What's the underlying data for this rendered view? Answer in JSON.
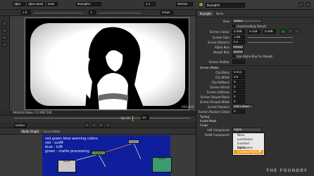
{
  "viewer": {
    "layer": "rgba",
    "alpha_layer": "rgba.alpha",
    "colorspace": "RGB",
    "input_a": "Keylight1",
    "gain": "1.0",
    "gamma": "1",
    "zoom": "1:1",
    "proxy": "sRGB",
    "lut": "default",
    "resolution": "960x540",
    "format_label": "960x540",
    "status": "960x540 bbox: 0 0 960 540",
    "frame": "24",
    "fps": "fps 24",
    "range_mode": "Global"
  },
  "node_panel": {
    "tabs": [
      "Node Graph",
      "Curve Editor"
    ],
    "sticky_note_lines": [
      "red green blue warning colors",
      "red - outM",
      "blue - inM",
      "green - matte processing"
    ],
    "nodes": [
      {
        "label": "Keylight1",
        "color": "#6fa04a"
      },
      {
        "label": "Read1",
        "color": "#c8c8c8"
      },
      {
        "label": "Read2",
        "color": "#c8c8c8"
      },
      {
        "label": "Viewer1",
        "color": "#9ab"
      }
    ]
  },
  "properties": {
    "title": "Keylight1",
    "tabs": [
      "Keylight",
      "Node"
    ],
    "view": {
      "label": "View",
      "value": "Status"
    },
    "unpremultiply": {
      "label": "Unpremultiply Result"
    },
    "screen_colour": {
      "label": "Screen Colour",
      "r": "0.008",
      "g": "0.358",
      "b": "0.008"
    },
    "rows": [
      {
        "label": "Screen Gain",
        "value": "1.08"
      },
      {
        "label": "Screen Balance",
        "value": "0.5"
      },
      {
        "label": "Alpha Bias",
        "value": ""
      },
      {
        "label": "Despill Bias",
        "value": ""
      }
    ],
    "use_alpha_despill": "Use Alpha Bias for Despill",
    "screen_prematte": "Screen PreBlur",
    "screen_matte_section": "Screen Matte",
    "matte_rows": [
      {
        "label": "Clip Black",
        "value": "0.015"
      },
      {
        "label": "Clip White",
        "value": "0.6"
      },
      {
        "label": "Clip Rollback",
        "value": "0"
      },
      {
        "label": "Screen Shrink",
        "value": "0"
      },
      {
        "label": "Screen Softness",
        "value": "0"
      },
      {
        "label": "Screen Despot Black",
        "value": "0"
      },
      {
        "label": "Screen Despot White",
        "value": "0"
      }
    ],
    "screen_replace": {
      "label": "Screen Replace",
      "value": "Soft Colour"
    },
    "screen_replace_colour": {
      "label": "Screen Replace Colour",
      "value": "0"
    },
    "sections": [
      "Tuning",
      "Inside Mask",
      "Crops"
    ],
    "inm_component": {
      "label": "InM Component",
      "value": "Alpha"
    },
    "outm_component": {
      "label": "OutM Component",
      "value": "None"
    },
    "dropdown_options": [
      "None",
      "Luminance",
      "Inverted Luminance",
      "Alpha",
      "Inverted Alpha"
    ],
    "dropdown_selected": 4
  },
  "watermark": "THE FOUNDRY"
}
